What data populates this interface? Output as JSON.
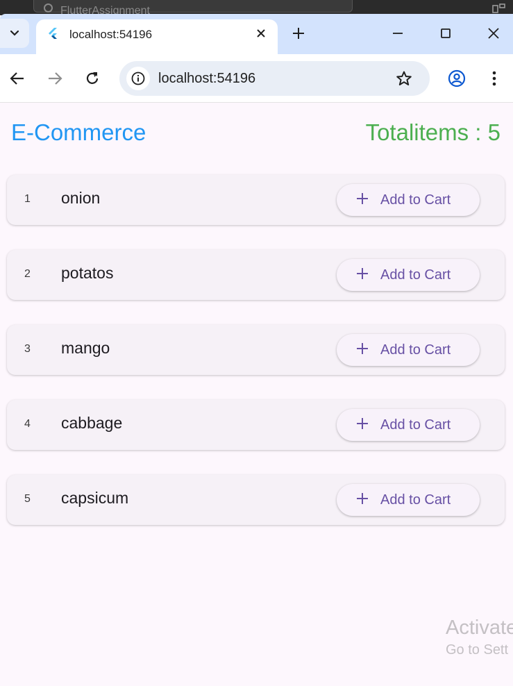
{
  "os": {
    "search_text": "FlutterAssignment"
  },
  "browser": {
    "tab_title": "localhost:54196",
    "url": "localhost:54196"
  },
  "app": {
    "title": "E-Commerce",
    "total": "Totalitems : 5",
    "items": [
      {
        "index": "1",
        "name": "onion",
        "button": "Add to Cart"
      },
      {
        "index": "2",
        "name": "potatos",
        "button": "Add to Cart"
      },
      {
        "index": "3",
        "name": "mango",
        "button": "Add to Cart"
      },
      {
        "index": "4",
        "name": "cabbage",
        "button": "Add to Cart"
      },
      {
        "index": "5",
        "name": "capsicum",
        "button": "Add to Cart"
      }
    ]
  },
  "watermark": {
    "line1": "Activate",
    "line2": "Go to Sett"
  },
  "colors": {
    "title": "#2196f3",
    "total": "#4caf50",
    "button_text": "#6750a4"
  }
}
